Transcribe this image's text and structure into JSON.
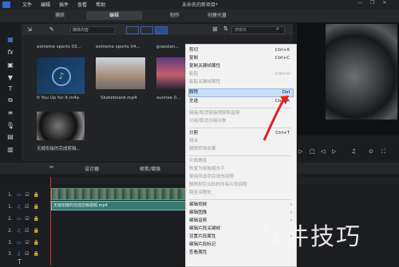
{
  "menubar": {
    "items": [
      "文件",
      "编辑",
      "插件",
      "查看",
      "帮助"
    ],
    "project_title": "未命名的新项目*",
    "window_controls": [
      "—",
      "❐",
      "✕"
    ]
  },
  "mode_tabs": [
    "捕获",
    "编辑",
    "制作",
    "创建光盘"
  ],
  "library": {
    "filter_value": "媒体内容",
    "search_placeholder": "搜索库",
    "items": [
      {
        "name": "extreme sports 03..."
      },
      {
        "name": "extreme sports 04..."
      },
      {
        "name": "grasslan..."
      },
      {
        "name": "It You Up for It.m4a"
      },
      {
        "name": "Skateboard.mp4"
      },
      {
        "name": "sunrise 0..."
      },
      {
        "name": "无缝衔接的完成剪辑..."
      }
    ]
  },
  "timeline": {
    "toolbar_labels": [
      "设计器",
      "修剪/增强"
    ],
    "tracks": [
      "1.",
      "1.",
      "2.",
      "2.",
      "3.",
      "3."
    ],
    "clip_label": "无缝衔接的完成剪辑视频.mp4"
  },
  "context_menu": {
    "items": [
      {
        "label": "剪切",
        "shortcut": "Ctrl+X",
        "enabled": true
      },
      {
        "label": "复制",
        "shortcut": "Ctrl+C",
        "enabled": true
      },
      {
        "label": "复制关键帧属性",
        "shortcut": "",
        "enabled": true
      },
      {
        "label": "粘贴",
        "shortcut": "Ctrl+V",
        "enabled": false
      },
      {
        "label": "粘贴关键帧属性",
        "shortcut": "",
        "enabled": false
      },
      {
        "label": "删除",
        "shortcut": "Del",
        "enabled": true,
        "highlighted": true
      },
      {
        "label": "全选",
        "shortcut": "Ctrl+A",
        "enabled": true
      },
      {
        "label": "链接/取消链接视频和音频",
        "shortcut": "",
        "enabled": false
      },
      {
        "label": "分组/取消分组对象",
        "shortcut": "",
        "enabled": false
      },
      {
        "label": "分割",
        "shortcut": "Ctrl+T",
        "enabled": true
      },
      {
        "label": "组合",
        "shortcut": "",
        "enabled": false
      },
      {
        "label": "删除转场效果",
        "shortcut": "",
        "enabled": false
      },
      {
        "label": "片段静音",
        "shortcut": "",
        "enabled": false
      },
      {
        "label": "恢复为原始缩水平",
        "shortcut": "",
        "enabled": false
      },
      {
        "label": "使用所选项目填充间隙",
        "shortcut": "",
        "enabled": false
      },
      {
        "label": "删除和空出轨的所有片段间隙",
        "shortcut": "",
        "enabled": false
      },
      {
        "label": "跳至间隙处",
        "shortcut": "",
        "enabled": false
      },
      {
        "label": "编辑视频",
        "shortcut": "",
        "enabled": true
      },
      {
        "label": "编辑图像",
        "shortcut": "",
        "enabled": true
      },
      {
        "label": "编辑音频",
        "shortcut": "",
        "enabled": true
      },
      {
        "label": "编辑片段关键帧",
        "shortcut": "",
        "enabled": true
      },
      {
        "label": "设置片段属性",
        "shortcut": "",
        "enabled": true
      },
      {
        "label": "编辑片段标记",
        "shortcut": "",
        "enabled": true
      },
      {
        "label": "查看属性",
        "shortcut": "",
        "enabled": true
      }
    ]
  },
  "watermark": "软件技巧",
  "colors": {
    "accent": "#2c6fd1",
    "menu_highlight": "#c7dff7",
    "arrow": "#e02020"
  }
}
